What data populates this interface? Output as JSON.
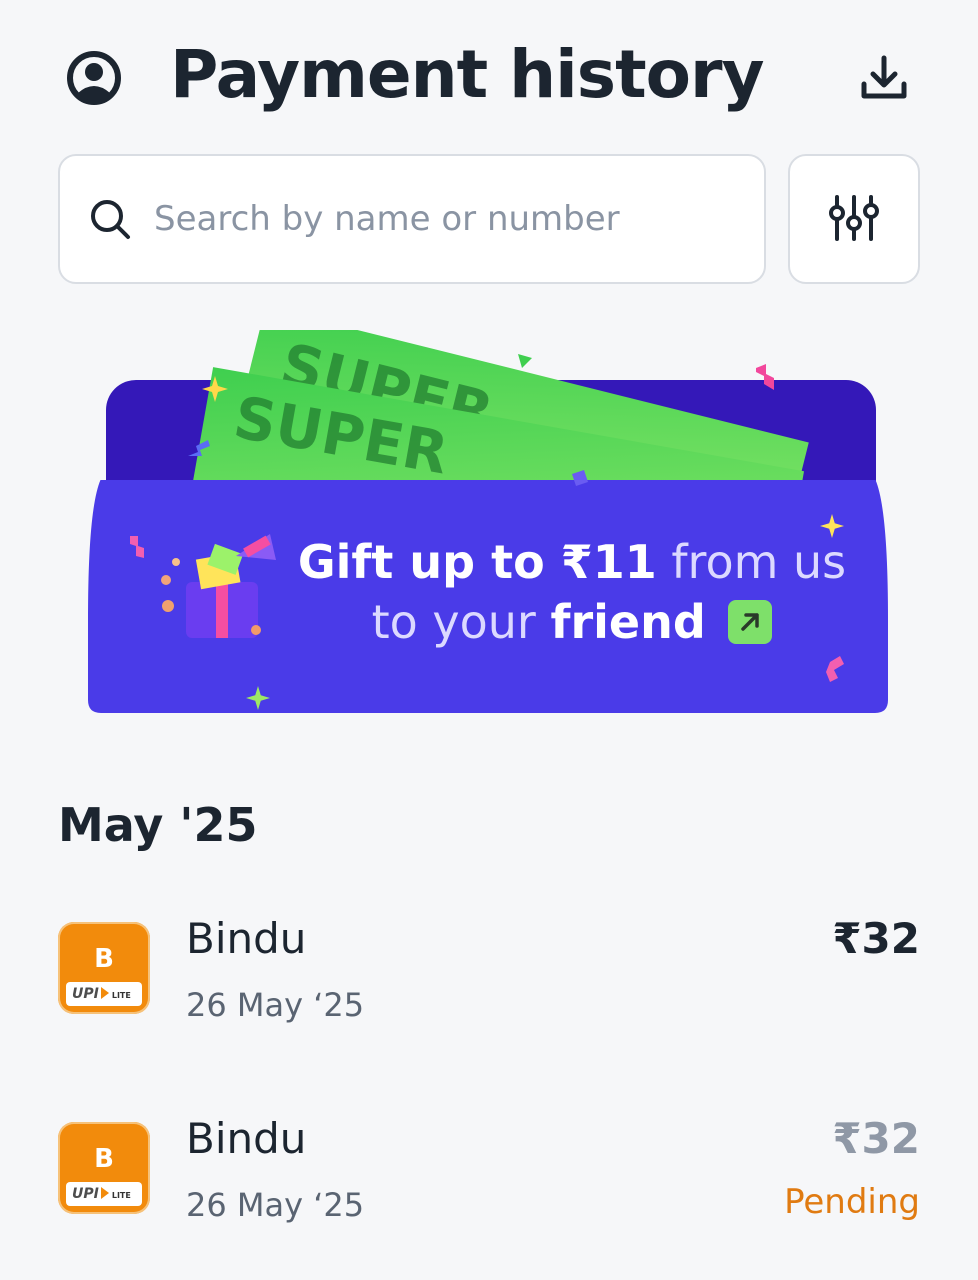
{
  "header": {
    "title": "Payment history",
    "profile_icon": "user-circle-icon",
    "download_icon": "download-icon"
  },
  "search": {
    "placeholder": "Search by name or number",
    "icon": "search-icon",
    "filter_icon": "sliders-icon"
  },
  "banner": {
    "line1_bold": "Gift up to ₹11",
    "line1_light": "from us",
    "line2_light": "to your",
    "line2_bold": "friend",
    "note_text": "SUPER",
    "arrow_icon": "arrow-up-right-icon",
    "colors": {
      "background": "#4a3be8",
      "back_panel": "#3418b8",
      "note": "#6ddc45",
      "badge": "#7ee06a"
    }
  },
  "section": {
    "title": "May '25"
  },
  "transactions": [
    {
      "initial": "B",
      "badge_text": "UPI",
      "badge_suffix": "LITE",
      "name": "Bindu",
      "date": "26 May ‘25",
      "amount": "₹32",
      "status": ""
    },
    {
      "initial": "B",
      "badge_text": "UPI",
      "badge_suffix": "LITE",
      "name": "Bindu",
      "date": "26 May ‘25",
      "amount": "₹32",
      "status": "Pending"
    }
  ],
  "colors": {
    "page_bg": "#f6f7f9",
    "text": "#1c2530",
    "avatar": "#f28b0c",
    "pending": "#e07b12"
  }
}
